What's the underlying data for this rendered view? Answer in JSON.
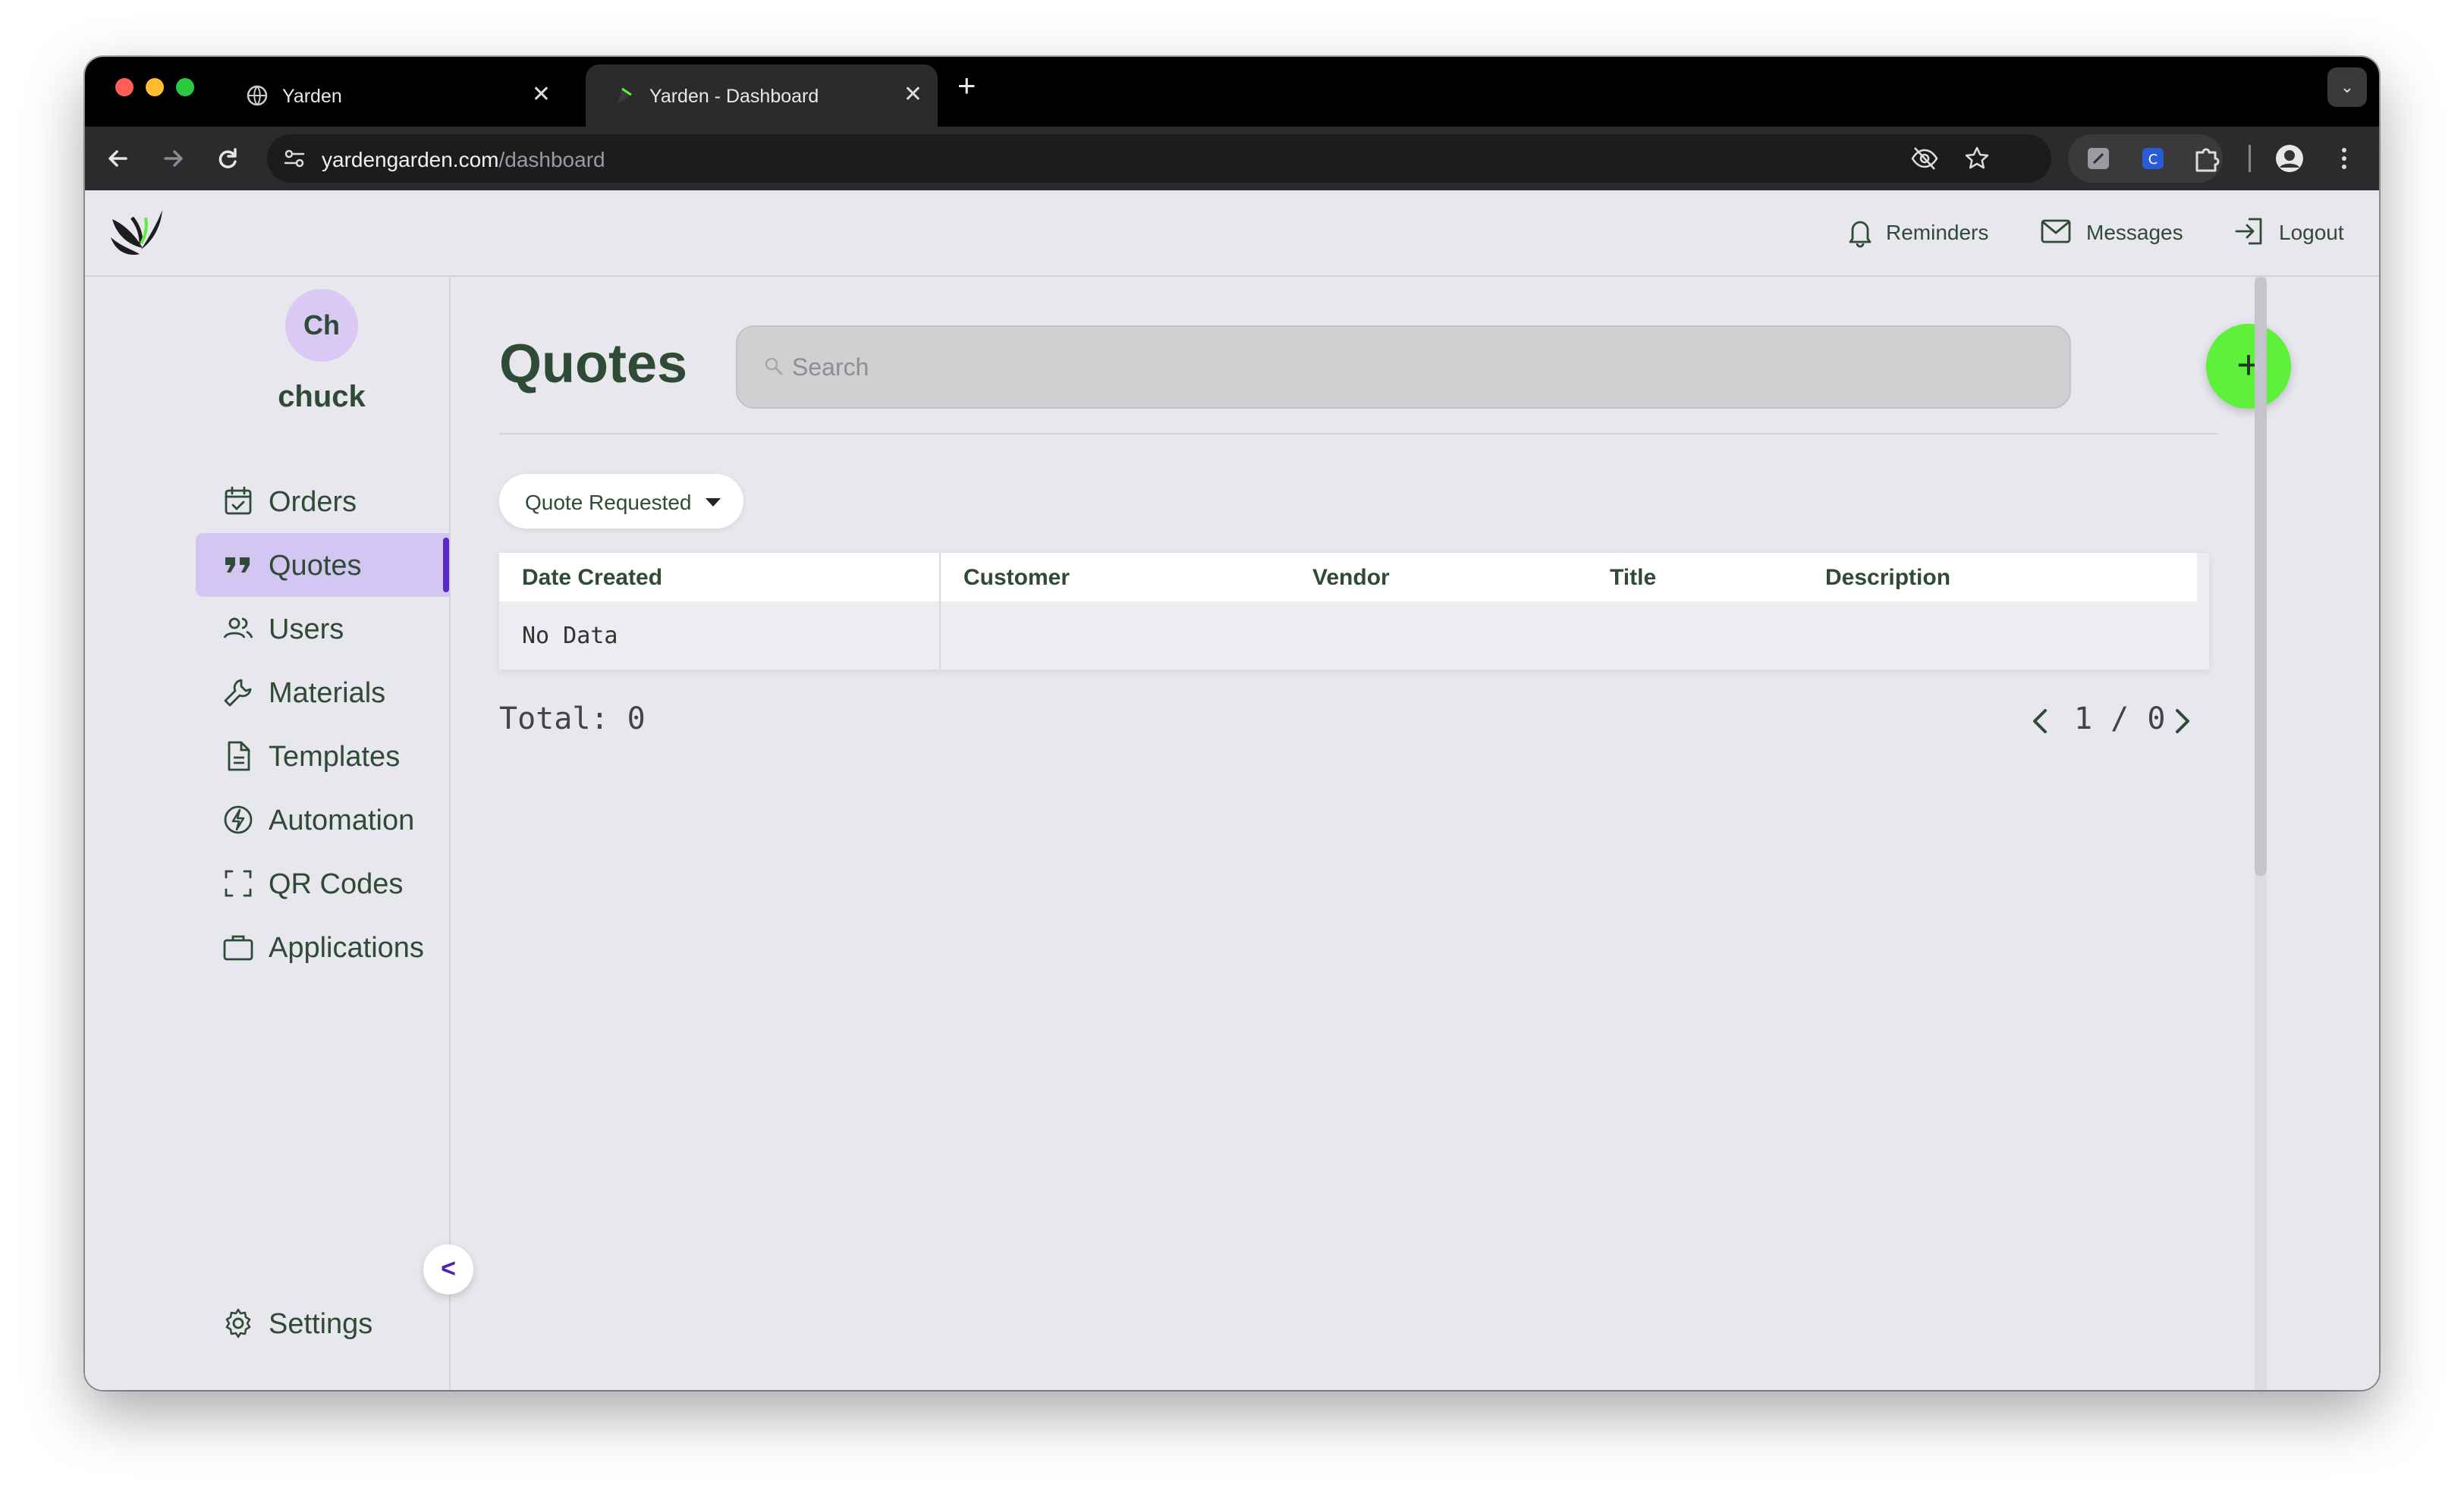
{
  "browser": {
    "tabs": [
      {
        "title": "Yarden",
        "active": false
      },
      {
        "title": "Yarden - Dashboard",
        "active": true
      }
    ],
    "url_host": "yardengarden.com",
    "url_path": "/dashboard"
  },
  "header": {
    "reminders": "Reminders",
    "messages": "Messages",
    "logout": "Logout"
  },
  "sidebar": {
    "avatar_initials": "Ch",
    "username": "chuck",
    "items": [
      {
        "label": "Orders",
        "icon": "calendar-check-icon"
      },
      {
        "label": "Quotes",
        "icon": "quote-icon",
        "active": true
      },
      {
        "label": "Users",
        "icon": "users-icon"
      },
      {
        "label": "Materials",
        "icon": "wrench-icon"
      },
      {
        "label": "Templates",
        "icon": "document-icon"
      },
      {
        "label": "Automation",
        "icon": "bolt-icon"
      },
      {
        "label": "QR Codes",
        "icon": "scan-frame-icon"
      },
      {
        "label": "Applications",
        "icon": "briefcase-icon"
      }
    ],
    "settings": "Settings",
    "collapse": "<"
  },
  "main": {
    "title": "Quotes",
    "search_placeholder": "Search",
    "add_label": "+",
    "filter_value": "Quote Requested",
    "table": {
      "columns": [
        "Date Created",
        "Customer",
        "Vendor",
        "Title",
        "Description"
      ],
      "empty_text": "No Data"
    },
    "total": "Total: 0",
    "pagination": "1 / 0"
  },
  "colors": {
    "accent_green": "#5ef03a",
    "text_green": "#2f4a35",
    "active_purple": "#d3c6f2",
    "active_bar": "#5a28c7"
  }
}
